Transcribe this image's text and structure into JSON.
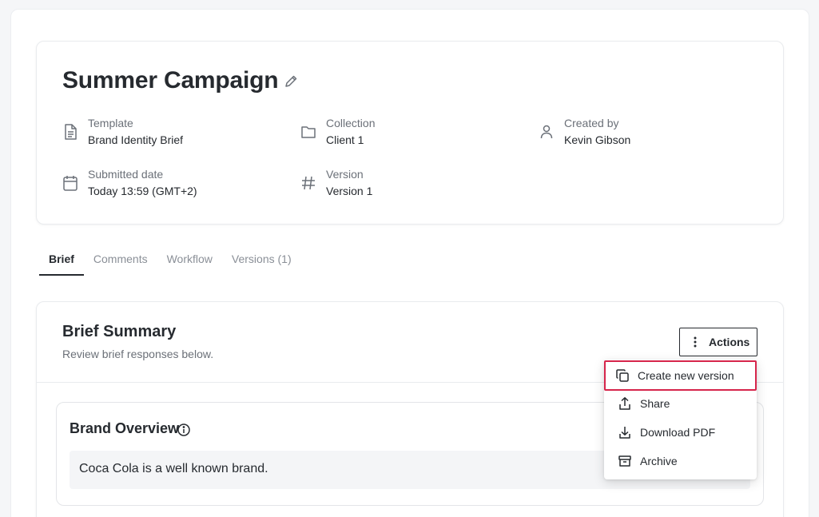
{
  "header": {
    "title": "Summer Campaign",
    "meta": {
      "template": {
        "label": "Template",
        "value": "Brand Identity Brief",
        "icon": "document-icon"
      },
      "collection": {
        "label": "Collection",
        "value": "Client 1",
        "icon": "folder-icon"
      },
      "created_by": {
        "label": "Created by",
        "value": "Kevin Gibson",
        "icon": "user-icon"
      },
      "submitted": {
        "label": "Submitted date",
        "value": "Today 13:59 (GMT+2)",
        "icon": "calendar-icon"
      },
      "version": {
        "label": "Version",
        "value": "Version 1",
        "icon": "hash-icon"
      }
    }
  },
  "tabs": [
    {
      "label": "Brief",
      "active": true
    },
    {
      "label": "Comments",
      "active": false
    },
    {
      "label": "Workflow",
      "active": false
    },
    {
      "label": "Versions (1)",
      "active": false
    }
  ],
  "summary": {
    "title": "Brief Summary",
    "subtitle": "Review brief responses below.",
    "actions_label": "Actions"
  },
  "actions_menu": [
    {
      "label": "Create new version",
      "icon": "copy-icon",
      "highlighted": true
    },
    {
      "label": "Share",
      "icon": "share-icon",
      "highlighted": false
    },
    {
      "label": "Download PDF",
      "icon": "download-icon",
      "highlighted": false
    },
    {
      "label": "Archive",
      "icon": "archive-icon",
      "highlighted": false
    }
  ],
  "section": {
    "title": "Brand Overview",
    "answer": "Coca Cola is a well known brand."
  },
  "colors": {
    "text": "#262a2f",
    "muted": "#6b7078",
    "highlight_border": "#d6254b"
  }
}
